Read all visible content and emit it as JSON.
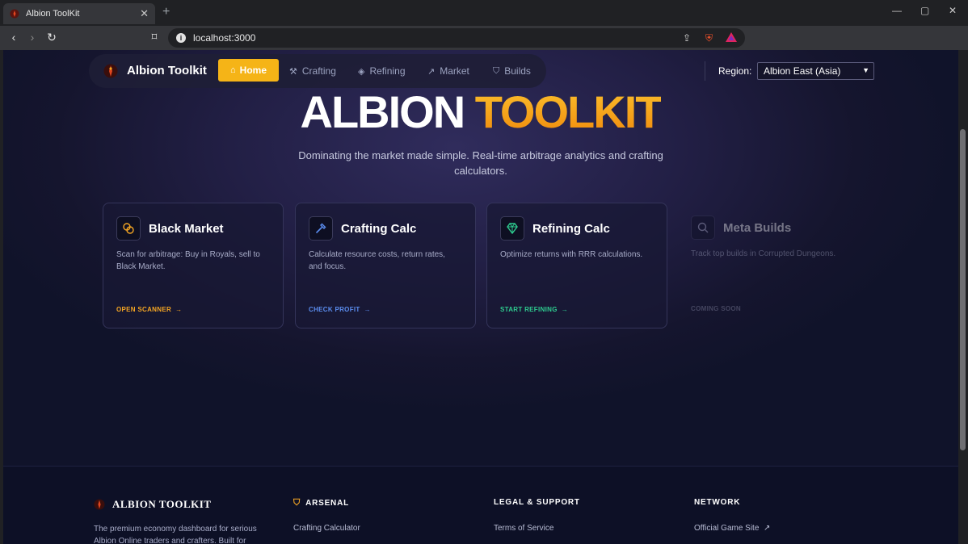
{
  "browser": {
    "tab_title": "Albion ToolKit",
    "tab_close": "✕",
    "new_tab": "+",
    "url": "localhost:3000",
    "win_minimize": "—",
    "win_maximize": "▢",
    "win_close": "✕"
  },
  "nav": {
    "brand": "Albion Toolkit",
    "items": [
      {
        "label": "Home",
        "icon": "home-icon"
      },
      {
        "label": "Crafting",
        "icon": "hammer-icon"
      },
      {
        "label": "Refining",
        "icon": "gem-icon"
      },
      {
        "label": "Market",
        "icon": "trend-icon"
      },
      {
        "label": "Builds",
        "icon": "shield-icon"
      }
    ],
    "region_label": "Region:",
    "region_value": "Albion East (Asia)"
  },
  "hero": {
    "title_part1": "ALBION",
    "title_part2": "TOOLKIT",
    "subtitle": "Dominating the market made simple. Real-time arbitrage analytics and crafting calculators."
  },
  "cards": [
    {
      "title": "Black Market",
      "desc": "Scan for arbitrage: Buy in Royals, sell to Black Market.",
      "cta": "OPEN SCANNER",
      "color": "#f5a623",
      "icon": "coins-icon"
    },
    {
      "title": "Crafting Calc",
      "desc": "Calculate resource costs, return rates, and focus.",
      "cta": "CHECK PROFIT",
      "color": "#5b8def",
      "icon": "hammer-icon"
    },
    {
      "title": "Refining Calc",
      "desc": "Optimize returns with RRR calculations.",
      "cta": "START REFINING",
      "color": "#2ecc8f",
      "icon": "gem-icon"
    },
    {
      "title": "Meta Builds",
      "desc": "Track top builds in Corrupted Dungeons.",
      "cta": "COMING SOON",
      "color": "#8a8ca8",
      "icon": "search-icon"
    }
  ],
  "footer": {
    "brand": "ALBION TOOLKIT",
    "text": "The premium economy dashboard for serious Albion Online traders and crafters. Built for",
    "columns": [
      {
        "heading": "ARSENAL",
        "link": "Crafting Calculator"
      },
      {
        "heading": "LEGAL & SUPPORT",
        "link": "Terms of Service"
      },
      {
        "heading": "NETWORK",
        "link": "Official Game Site"
      }
    ]
  },
  "colors": {
    "accent": "#f5b417",
    "gold": "#f5a623"
  }
}
